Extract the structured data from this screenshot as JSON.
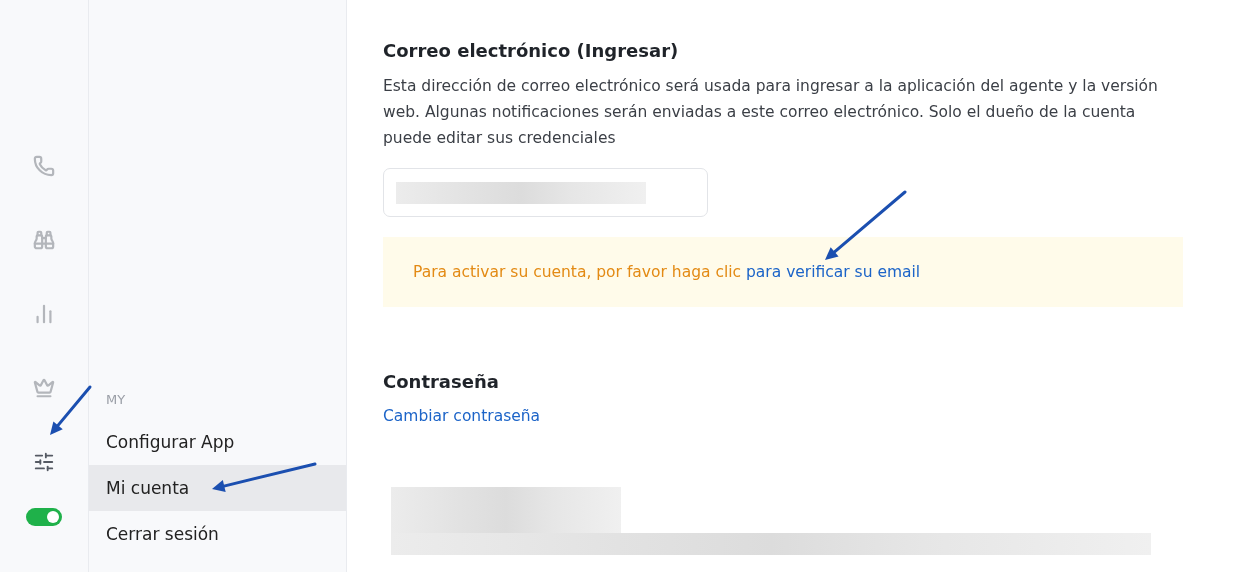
{
  "rail": {
    "items": [
      {
        "kind": "phone",
        "selected": false
      },
      {
        "kind": "binoculars",
        "selected": false
      },
      {
        "kind": "chart",
        "selected": false
      },
      {
        "kind": "crown",
        "selected": false
      },
      {
        "kind": "sliders",
        "selected": true
      }
    ],
    "status_toggle": {
      "on": true
    }
  },
  "submenu": {
    "section": "MY",
    "items": [
      {
        "label": "Configurar App",
        "selected": false
      },
      {
        "label": "Mi cuenta",
        "selected": true
      },
      {
        "label": "Cerrar sesión",
        "selected": false
      }
    ]
  },
  "email_section": {
    "title": "Correo electrónico (Ingresar)",
    "description": "Esta dirección de correo electrónico será usada para ingresar a la aplicación del agente y la versión web. Algunas notificaciones serán enviadas a este correo electrónico. Solo el dueño de la cuenta puede editar sus credenciales",
    "alert": {
      "text": "Para activar su cuenta, por favor haga clic",
      "link": "para verificar su email"
    }
  },
  "password_section": {
    "title": "Contraseña",
    "link": "Cambiar contraseña"
  }
}
